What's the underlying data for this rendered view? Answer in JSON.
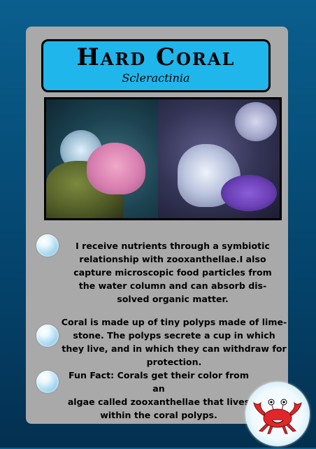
{
  "card": {
    "title": "Hard Coral",
    "subtitle": "Scleractinia"
  },
  "facts": [
    {
      "lines": [
        "I receive nutrients through a symbiotic",
        "relationship with zooxanthellae.I also",
        "capture microscopic food particles from",
        "the water column and can absorb dis-",
        "solved organic matter."
      ]
    },
    {
      "lines": [
        "Coral is made up of tiny polyps made of lime-",
        "stone. The polyps secrete a cup in which",
        "they live, and in which they can withdraw for",
        "protection."
      ]
    },
    {
      "lines": [
        "Fun Fact: Corals get their color from an",
        "algae called zooxanthellae that lives",
        "within the coral polyps."
      ]
    }
  ],
  "icons": {
    "fact_bullet": "bubble-icon",
    "mascot": "crab-icon"
  },
  "colors": {
    "background": "#064f7a",
    "card": "#a9a9aa",
    "title_box": "#1fb6ec",
    "crab": "#e0262b"
  }
}
